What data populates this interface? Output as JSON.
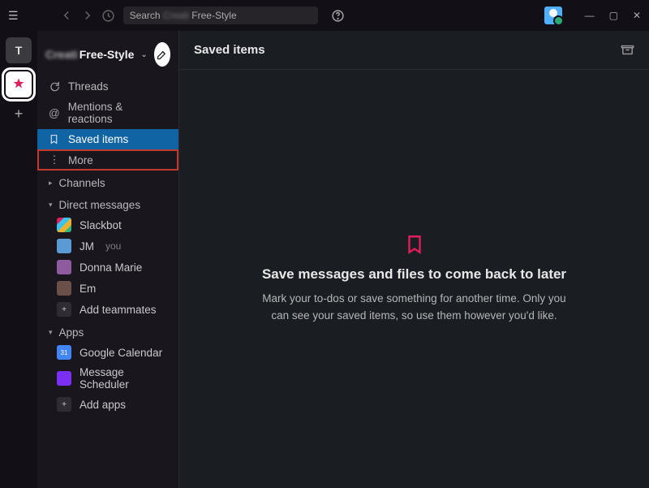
{
  "titlebar": {
    "search_prefix": "Search",
    "search_text": "Free-Style",
    "workspaces": {
      "t_label": "T"
    }
  },
  "sidebar": {
    "workspace_name_blur": "Creati",
    "workspace_name": "Free-Style",
    "items": [
      {
        "icon": "threads-icon",
        "label": "Threads"
      },
      {
        "icon": "mentions-icon",
        "label": "Mentions & reactions"
      },
      {
        "icon": "bookmark-icon",
        "label": "Saved items"
      },
      {
        "icon": "more-icon",
        "label": "More"
      }
    ],
    "sections": {
      "channels": "Channels",
      "dms": "Direct messages",
      "apps": "Apps"
    },
    "dms": [
      {
        "name": "Slackbot",
        "avatar": "slackbot"
      },
      {
        "name": "JM",
        "avatar": "jm",
        "suffix": "you"
      },
      {
        "name": "Donna Marie",
        "avatar": "dm1"
      },
      {
        "name": "Em",
        "avatar": "em"
      }
    ],
    "add_teammates": "Add teammates",
    "apps": [
      {
        "name": "Google Calendar",
        "avatar": "gcal"
      },
      {
        "name": "Message Scheduler",
        "avatar": "msched"
      }
    ],
    "add_apps": "Add apps"
  },
  "main": {
    "title": "Saved items",
    "empty_heading": "Save messages and files to come back to later",
    "empty_body": "Mark your to-dos or save something for another time. Only you can see your saved items, so use them however you'd like."
  }
}
